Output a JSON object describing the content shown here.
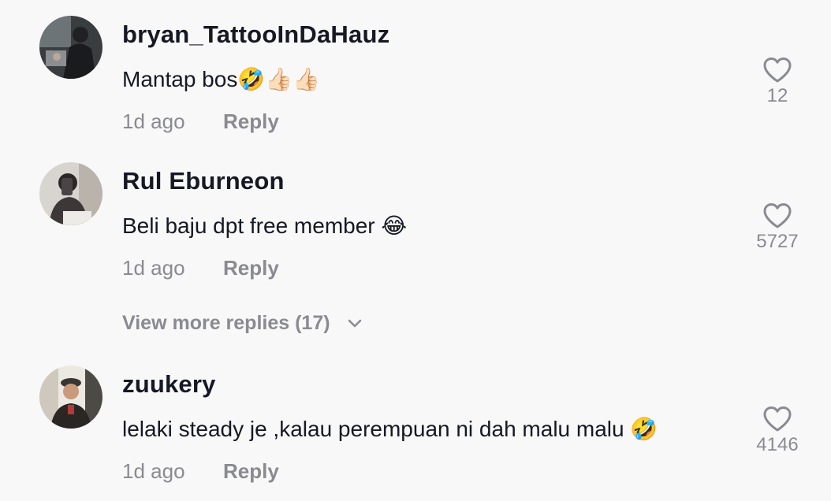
{
  "comments": [
    {
      "username": "bryan_TattooInDaHauz",
      "text": "Mantap bos🤣👍🏻👍🏻",
      "time": "1d ago",
      "reply_label": "Reply",
      "likes": "12"
    },
    {
      "username": "Rul Eburneon",
      "text": "Beli baju dpt free member 😂",
      "time": "1d ago",
      "reply_label": "Reply",
      "likes": "5727"
    },
    {
      "username": "zuukery",
      "text": "lelaki steady je ,kalau perempuan ni dah malu malu 🤣",
      "time": "1d ago",
      "reply_label": "Reply",
      "likes": "4146"
    }
  ],
  "view_more_replies": "View more replies (17)",
  "icons": {
    "like": "heart-outline-icon",
    "expand": "chevron-down-icon"
  },
  "colors": {
    "background": "#f8f8f8",
    "primary_text": "#161823",
    "secondary_text": "#8a8b91"
  }
}
